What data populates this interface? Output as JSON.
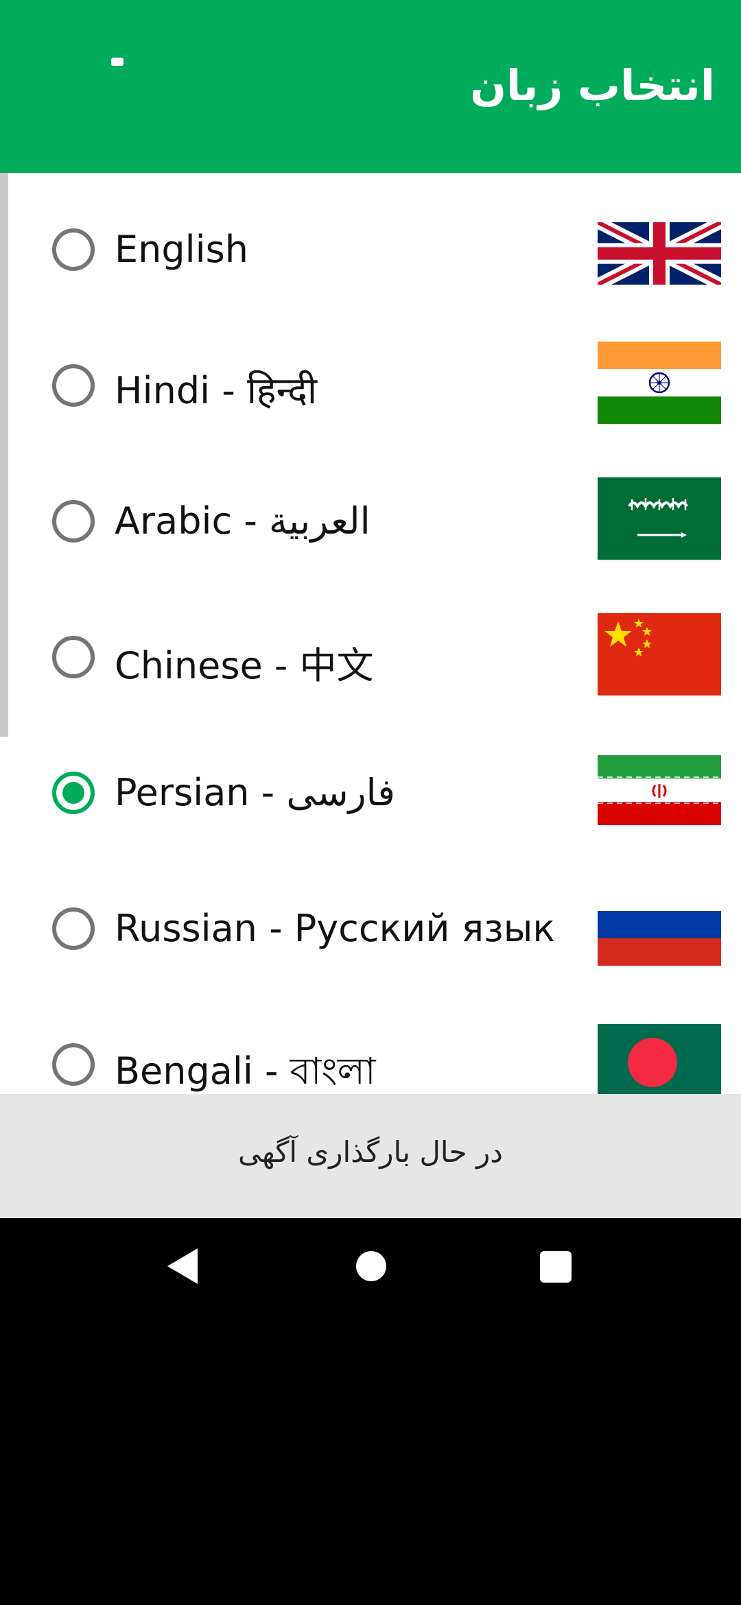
{
  "appbar": {
    "title": "انتخاب زبان"
  },
  "languages": [
    {
      "label": "English",
      "selected": false,
      "flag": "uk-flag-icon"
    },
    {
      "label": "Hindi - हिन्दी",
      "selected": false,
      "flag": "india-flag-icon"
    },
    {
      "label": "Arabic - العربية",
      "selected": false,
      "flag": "saudi-arabia-flag-icon"
    },
    {
      "label": "Chinese - 中文",
      "selected": false,
      "flag": "china-flag-icon"
    },
    {
      "label": "Persian - فارسی",
      "selected": true,
      "flag": "iran-flag-icon"
    },
    {
      "label": "Russian - Русский язык",
      "selected": false,
      "flag": "russia-flag-icon"
    },
    {
      "label": "Bengali - বাংলা",
      "selected": false,
      "flag": "bangladesh-flag-icon"
    }
  ],
  "ad": {
    "loading_text": "در حال بارگذاری آگهی"
  },
  "colors": {
    "primary": "#00AB5B",
    "radio_unchecked": "#757575"
  },
  "nav": {
    "back": "back-icon",
    "home": "home-icon",
    "recents": "recents-icon"
  }
}
